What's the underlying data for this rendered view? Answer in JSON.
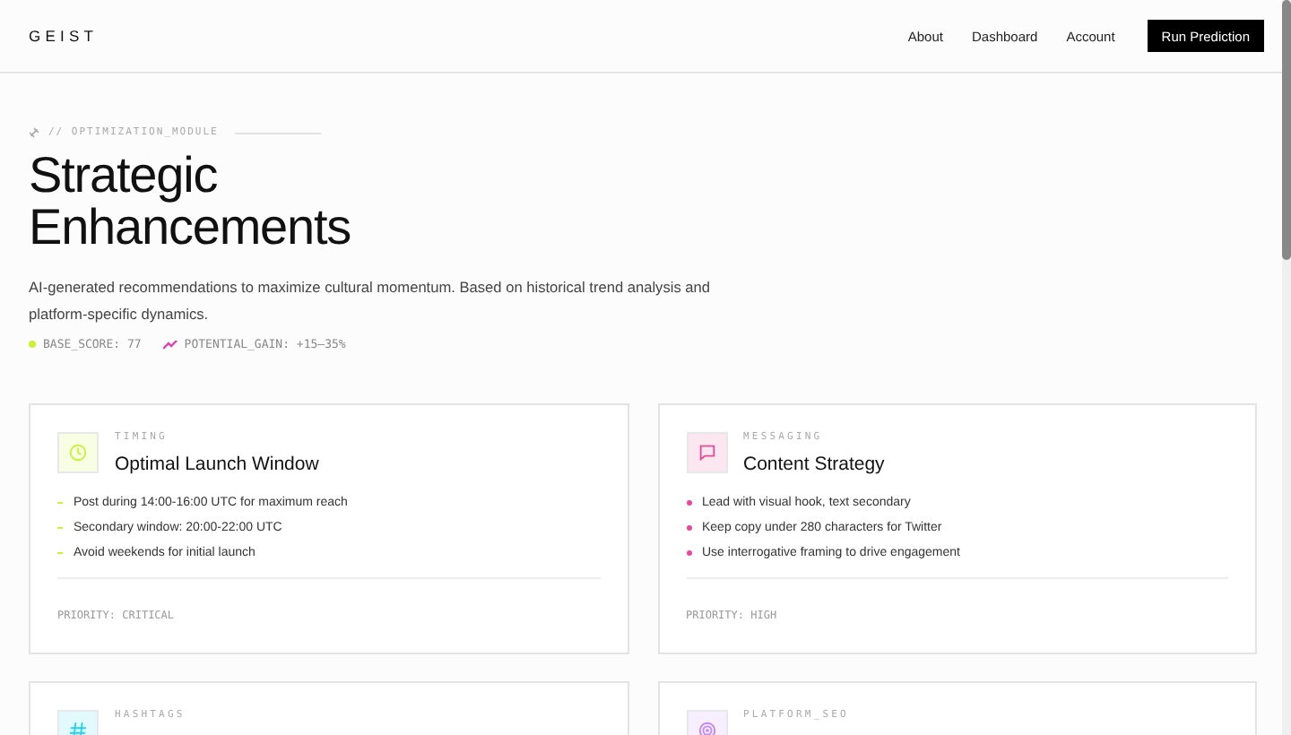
{
  "header": {
    "logo": "GEIST",
    "nav": [
      {
        "label": "About"
      },
      {
        "label": "Dashboard"
      },
      {
        "label": "Account"
      }
    ],
    "action": "Run Prediction"
  },
  "hero": {
    "module_label": "// OPTIMIZATION_MODULE",
    "title_lines": [
      "Strategic",
      "Enhancements"
    ],
    "description": "AI-generated recommendations to maximize cultural momentum. Based on historical trend analysis and platform-specific dynamics.",
    "stats": [
      {
        "kind": "dot",
        "text": "BASE_SCORE: 77",
        "color": "#c6f432"
      },
      {
        "kind": "trend",
        "text": "POTENTIAL_GAIN: +15–35%",
        "color": "#e040b0"
      }
    ]
  },
  "cards": [
    {
      "kind": "clock",
      "category": "TIMING",
      "title": "Optimal Launch Window",
      "color": "#c6f432",
      "bullets": [
        "Post during 14:00-16:00 UTC for maximum reach",
        "Secondary window: 20:00-22:00 UTC",
        "Avoid weekends for initial launch"
      ],
      "priority": "PRIORITY: CRITICAL"
    },
    {
      "kind": "message",
      "category": "MESSAGING",
      "title": "Content Strategy",
      "color": "#ec4899",
      "bullets": [
        "Lead with visual hook, text secondary",
        "Keep copy under 280 characters for Twitter",
        "Use interrogative framing to drive engagement"
      ],
      "priority": "PRIORITY: HIGH"
    },
    {
      "kind": "hash",
      "category": "HASHTAGS",
      "color": "#22d3ee"
    },
    {
      "kind": "target",
      "category": "PLATFORM_SEO",
      "color": "#c084fc"
    }
  ]
}
